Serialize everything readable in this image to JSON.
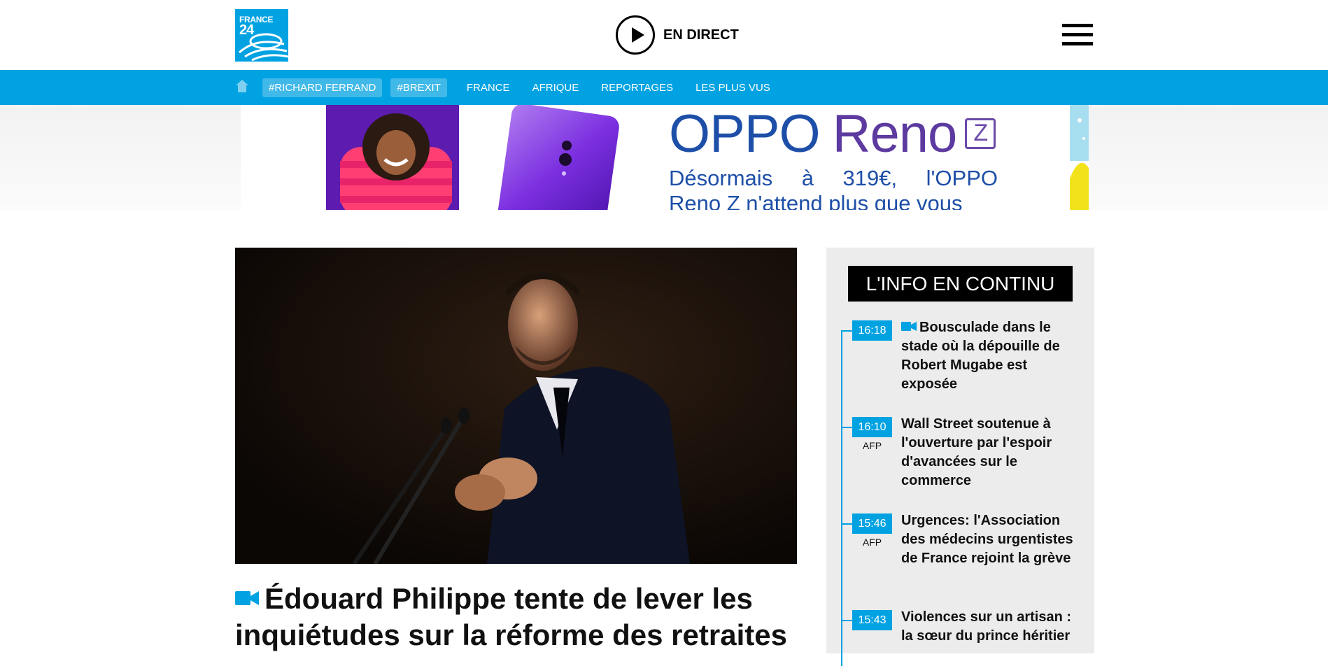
{
  "header": {
    "logo_line1": "FRANCE",
    "logo_line2": "24",
    "live_label": "EN DIRECT"
  },
  "nav": {
    "tags": [
      "#RICHARD FERRAND",
      "#BREXIT"
    ],
    "links": [
      "FRANCE",
      "AFRIQUE",
      "REPORTAGES",
      "LES PLUS VUS"
    ]
  },
  "ad": {
    "brand_oppo": "OPPO",
    "brand_reno": "Reno",
    "brand_z": "Z",
    "tagline_line1": "Désormais à 319€, l'OPPO",
    "tagline_line2": "Reno Z n'attend plus que vous"
  },
  "article": {
    "headline": "Édouard Philippe tente de lever les inquiétudes sur la réforme des retraites"
  },
  "sidebar": {
    "title": "L'INFO EN CONTINU",
    "items": [
      {
        "time": "16:18",
        "source": "",
        "video": true,
        "text": "Bousculade dans le stade où la dépouille de Robert Mugabe est exposée"
      },
      {
        "time": "16:10",
        "source": "AFP",
        "video": false,
        "text": "Wall Street soutenue à l'ouverture par l'espoir d'avancées sur le commerce"
      },
      {
        "time": "15:46",
        "source": "AFP",
        "video": false,
        "text": "Urgences: l'Association des médecins urgentistes de France rejoint la grève"
      },
      {
        "time": "15:43",
        "source": "",
        "video": false,
        "text": "Violences sur un artisan : la sœur du prince héritier"
      }
    ]
  },
  "colors": {
    "brand_blue": "#00a2e1",
    "oppo_blue": "#1e4fa8",
    "oppo_purple": "#5c3aa0"
  },
  "icons": {
    "live": "play-circle-icon",
    "menu": "hamburger-menu-icon",
    "home": "home-icon",
    "video": "video-camera-icon"
  }
}
